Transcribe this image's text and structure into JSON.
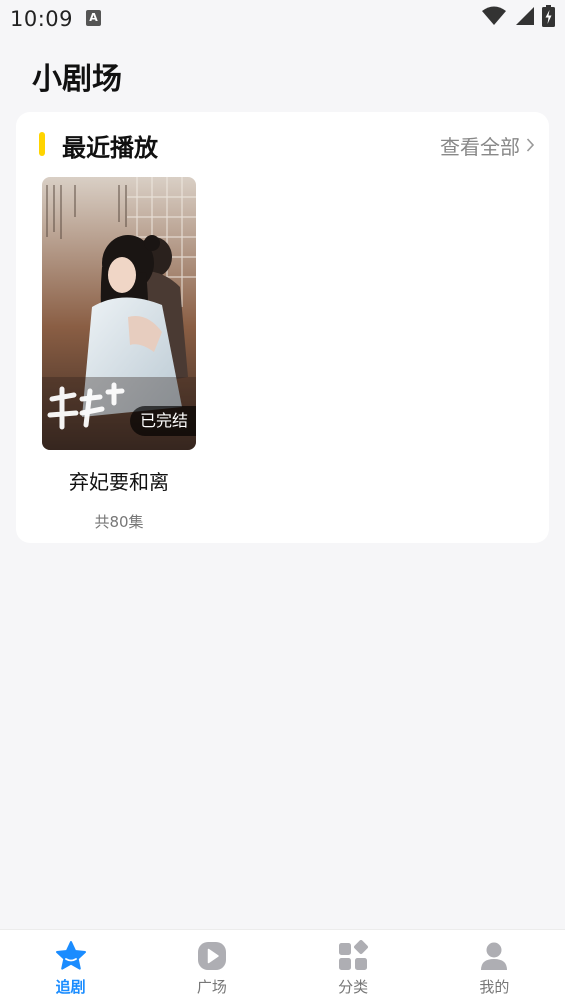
{
  "status_bar": {
    "time": "10:09",
    "notification_badge": "A",
    "icons": [
      "wifi-icon",
      "signal-icon",
      "battery-charging-icon"
    ]
  },
  "page": {
    "title": "小剧场"
  },
  "recent": {
    "title": "最近播放",
    "view_all_label": "查看全部",
    "accent_color": "#ffd400",
    "items": [
      {
        "name": "弃妃要和离",
        "episodes": "共80集",
        "badge": "已完结"
      }
    ]
  },
  "bottom_nav": {
    "active_color": "#1a8cff",
    "inactive_color": "#777777",
    "items": [
      {
        "label": "追剧",
        "icon": "star-icon",
        "active": true
      },
      {
        "label": "广场",
        "icon": "play-icon",
        "active": false
      },
      {
        "label": "分类",
        "icon": "grid-icon",
        "active": false
      },
      {
        "label": "我的",
        "icon": "user-icon",
        "active": false
      }
    ]
  }
}
